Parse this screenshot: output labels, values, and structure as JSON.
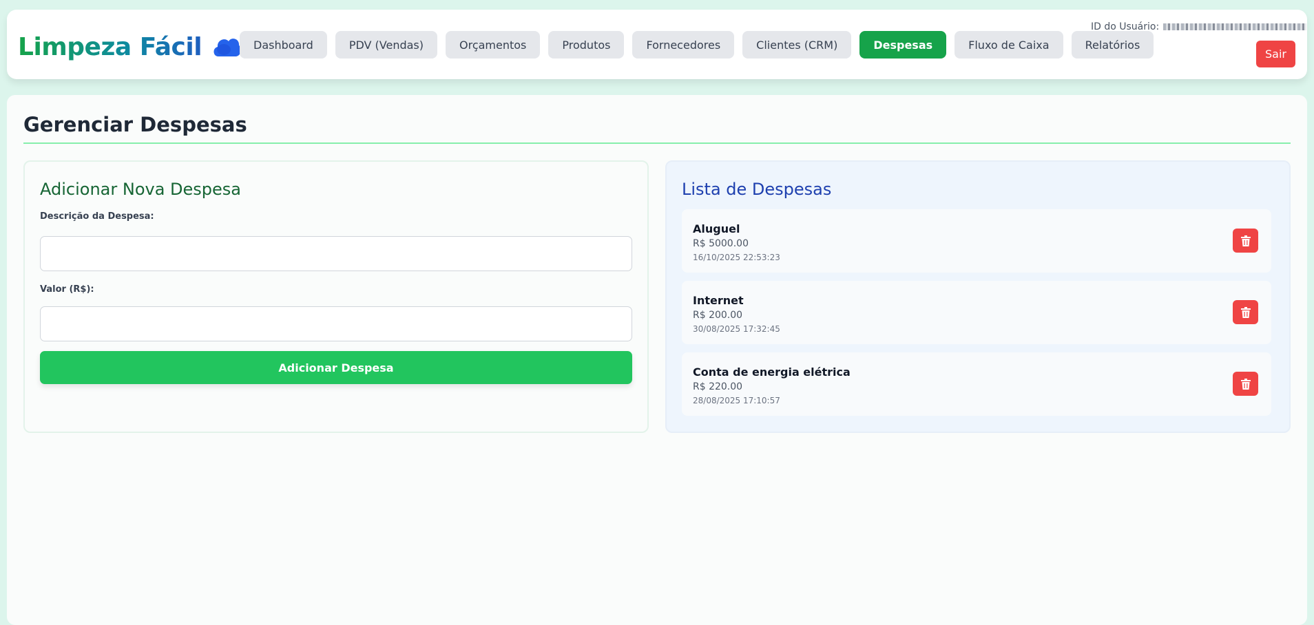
{
  "header": {
    "brand": "Limpeza Fácil",
    "brand_icon": "cloud-icon",
    "user_id_label": "ID do Usuário:",
    "logout_label": "Sair"
  },
  "nav": {
    "items": [
      {
        "label": "Dashboard"
      },
      {
        "label": "PDV (Vendas)"
      },
      {
        "label": "Orçamentos"
      },
      {
        "label": "Produtos"
      },
      {
        "label": "Fornecedores"
      },
      {
        "label": "Clientes (CRM)"
      },
      {
        "label": "Despesas",
        "active": true
      },
      {
        "label": "Fluxo de Caixa"
      },
      {
        "label": "Relatórios"
      }
    ]
  },
  "page": {
    "title": "Gerenciar Despesas"
  },
  "add_form": {
    "title": "Adicionar Nova Despesa",
    "description_label": "Descrição da Despesa:",
    "description_value": "",
    "value_label": "Valor (R$):",
    "value_value": "",
    "submit_label": "Adicionar Despesa"
  },
  "expense_list": {
    "title": "Lista de Despesas",
    "delete_icon": "trash-icon",
    "items": [
      {
        "name": "Aluguel",
        "value": "R$ 5000.00",
        "date": "16/10/2025 22:53:23"
      },
      {
        "name": "Internet",
        "value": "R$ 200.00",
        "date": "30/08/2025 17:32:45"
      },
      {
        "name": "Conta de energia elétrica",
        "value": "R$ 220.00",
        "date": "28/08/2025 17:10:57"
      }
    ]
  },
  "colors": {
    "primary_green": "#16a34a",
    "button_green": "#22c55e",
    "danger_red": "#ef4444",
    "list_title_blue": "#1e40af",
    "form_title_green": "#166534"
  }
}
